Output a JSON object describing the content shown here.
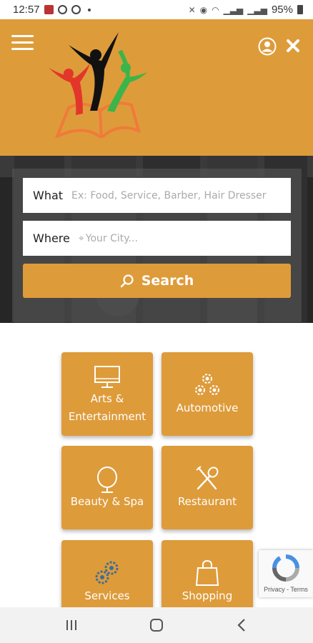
{
  "status_bar": {
    "time": "12:57",
    "battery": "95%"
  },
  "header": {
    "menu_icon": "hamburger-menu-icon",
    "logo_icon": "people-book-logo",
    "account_icon": "user-account-icon",
    "close_icon": "close-icon",
    "brand_color": "#de9b3a"
  },
  "search": {
    "what_label": "What",
    "what_placeholder": "Ex: Food, Service, Barber, Hair Dresser",
    "where_label": "Where",
    "where_placeholder": "Your City...",
    "button_label": "Search"
  },
  "categories": [
    {
      "label_line1": "Arts &",
      "label_line2": "Entertainment",
      "icon": "monitor-icon"
    },
    {
      "label": "Automotive",
      "icon": "gears-icon"
    },
    {
      "label": "Beauty & Spa",
      "icon": "mirror-icon"
    },
    {
      "label": "Restaurant",
      "icon": "fork-spoon-icon"
    },
    {
      "label": "Services",
      "icon": "cogs-icon"
    },
    {
      "label": "Shopping",
      "icon": "shopping-bag-icon"
    }
  ],
  "recaptcha": {
    "text": "Privacy - Terms"
  },
  "navigation": {
    "recents_icon": "recents-icon",
    "home_icon": "home-icon",
    "back_icon": "back-icon"
  }
}
